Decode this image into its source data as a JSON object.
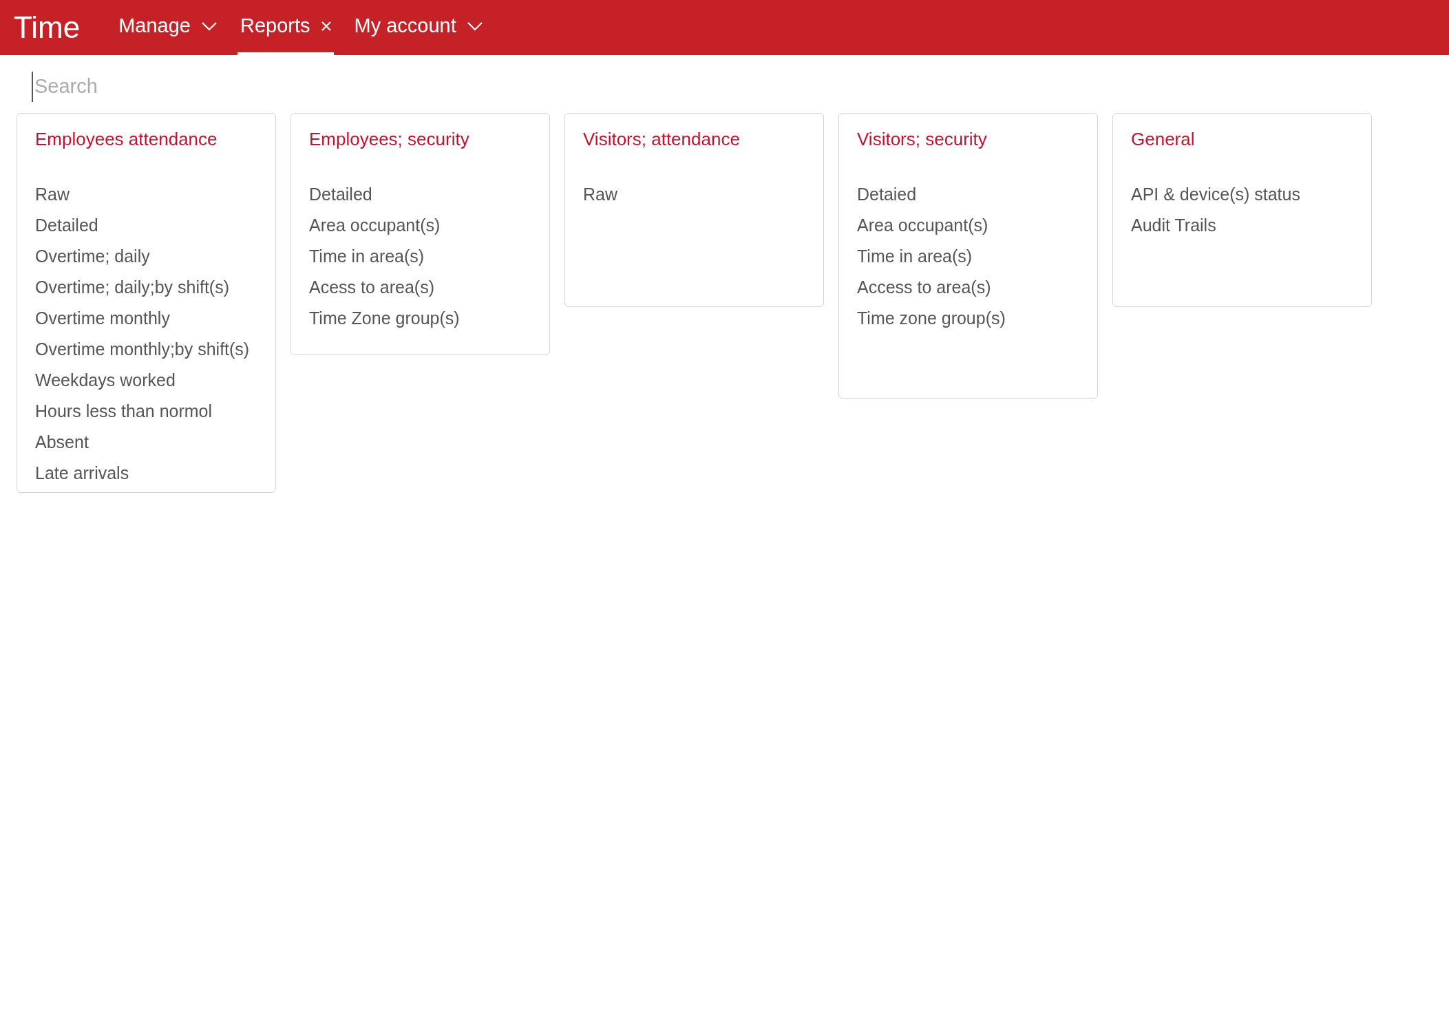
{
  "app": {
    "title": "Time"
  },
  "nav": [
    {
      "label": "Manage",
      "kind": "dropdown",
      "selected": false
    },
    {
      "label": "Reports",
      "kind": "closable",
      "selected": true
    },
    {
      "label": "My account",
      "kind": "dropdown",
      "selected": false
    }
  ],
  "search": {
    "placeholder": "Search"
  },
  "groups": [
    {
      "title": "Employees attendance",
      "items": [
        "Raw",
        "Detailed",
        "Overtime; daily",
        "Overtime; daily;by shift(s)",
        "Overtime monthly",
        "Overtime monthly;by shift(s)",
        "Weekdays worked",
        "Hours less than normol",
        "Absent",
        "Late arrivals"
      ]
    },
    {
      "title": "Employees; security",
      "items": [
        "Detailed",
        "Area occupant(s)",
        "Time in area(s)",
        "Acess to area(s)",
        "Time Zone group(s)"
      ]
    },
    {
      "title": "Visitors; attendance",
      "items": [
        "Raw"
      ]
    },
    {
      "title": "Visitors; security",
      "items": [
        "Detaied",
        "Area occupant(s)",
        "Time in area(s)",
        "Access to area(s)",
        "Time zone group(s)"
      ]
    },
    {
      "title": "General",
      "items": [
        "API & device(s) status",
        "Audit Trails"
      ]
    }
  ]
}
